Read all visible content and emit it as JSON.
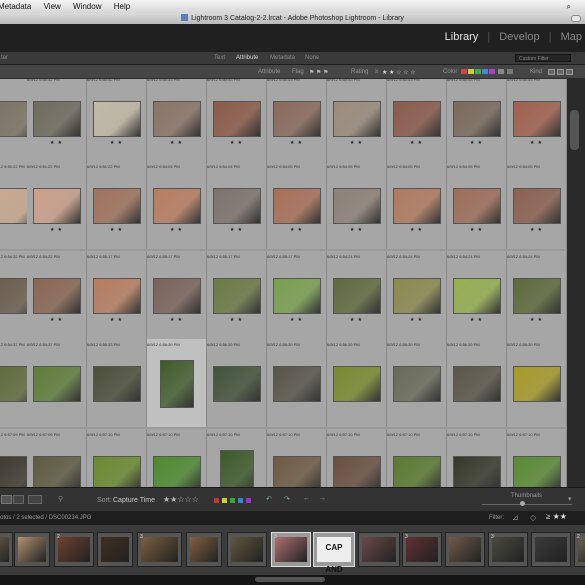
{
  "menubar": {
    "items": [
      "Metadata",
      "View",
      "Window",
      "Help"
    ]
  },
  "window": {
    "title": "Lightroom 3 Catalog-2-2.lrcat - Adobe Photoshop Lightroom - Library"
  },
  "modules": {
    "library": "Library",
    "develop": "Develop",
    "map": "Map",
    "sep": "|"
  },
  "filterbar": {
    "label": "ter",
    "text": "Text",
    "attribute": "Attribute",
    "metadata": "Metadata",
    "none": "None",
    "custom": "Custom Filter"
  },
  "attrbar": {
    "attribute": "Attribute",
    "flag": "Flag",
    "rating": "Rating",
    "rating_op": "≥",
    "color": "Color",
    "kind": "Kind"
  },
  "grid": {
    "rows": [
      {
        "info": [
          "",
          "6/9/12 6:50:52 PM",
          "6/9/12 6:50:52 PM",
          "6/9/12 6:50:53 PM",
          "6/9/12 6:50:53 PM",
          "6/9/12 6:50:53 PM",
          "6/9/12 6:50:53 PM",
          "6/9/12 6:50:53 PM",
          "6/9/12 6:50:53 PM",
          "6/9/12 6:50:53 PM"
        ],
        "stars": [
          "",
          "★ ★",
          "★ ★",
          "★ ★",
          "★ ★",
          "★ ★",
          "★ ★",
          "★ ★",
          "★ ★",
          "★ ★"
        ]
      },
      {
        "info": [
          "6/9/12 6:50:22 PM",
          "6/9/12 6:51:22 PM",
          "6/9/12 6:51:22 PM",
          "6/9/12 6:54:04 PM",
          "6/9/12 6:54:04 PM",
          "6/9/12 6:54:05 PM",
          "6/9/12 6:54:05 PM",
          "6/9/12 6:54:05 PM",
          "6/9/12 6:54:05 PM",
          "6/9/12 6:54:05 PM"
        ],
        "stars": [
          "",
          "★ ★",
          "★ ★",
          "★ ★",
          "★ ★",
          "★ ★",
          "★ ★",
          "★ ★",
          "★ ★",
          "★ ★"
        ]
      },
      {
        "info": [
          "6/9/12 6:54:22 PM",
          "6/9/12 6:54:22 PM",
          "6/9/12 6:55:17 PM",
          "6/9/12 6:55:17 PM",
          "6/9/12 6:55:17 PM",
          "6/9/12 6:55:17 PM",
          "6/9/12 6:54:24 PM",
          "6/9/12 6:54:24 PM",
          "6/9/12 6:54:24 PM",
          "6/9/12 6:54:24 PM"
        ],
        "stars": [
          "",
          "★ ★",
          "★ ★",
          "★ ★",
          "★ ★",
          "★ ★",
          "★ ★",
          "★ ★",
          "★ ★",
          "★ ★"
        ]
      },
      {
        "info": [
          "6/9/12 6:54:37 PM",
          "6/9/12 6:54:37 PM",
          "6/9/12 6:55:33 PM",
          "6/9/12 6:56:39 PM",
          "6/9/12 6:56:39 PM",
          "6/9/12 6:56:39 PM",
          "6/9/12 6:56:39 PM",
          "6/9/12 6:56:39 PM",
          "6/9/12 6:56:39 PM",
          "6/9/12 6:56:39 PM"
        ],
        "stars": [
          "",
          "",
          "",
          "",
          "",
          "",
          "",
          "",
          "",
          ""
        ]
      },
      {
        "info": [
          "6/9/12 6:57:09 PM",
          "6/9/12 6:57:09 PM",
          "6/9/12 6:57:10 PM",
          "6/9/12 6:57:10 PM",
          "6/9/12 6:57:10 PM",
          "6/9/12 6:57:10 PM",
          "6/9/12 6:57:10 PM",
          "6/9/12 6:57:10 PM",
          "6/9/12 6:57:10 PM",
          "6/9/12 6:57:10 PM"
        ],
        "stars": [
          "",
          "",
          "",
          "",
          "",
          "",
          "",
          "",
          "",
          ""
        ]
      }
    ]
  },
  "toolbar": {
    "sort_label": "Sort:",
    "sort_value": "Capture Time",
    "thumbnails": "Thumbnails"
  },
  "filmstrip": {
    "status": "otos / 2 selected / DSC00234.JPG",
    "filter_label": "Filter:",
    "tile_text": "CAP AND",
    "nums": [
      "2",
      "3",
      "3",
      "3",
      "3",
      "2"
    ]
  },
  "colors": {
    "accent": "#e6e6e6",
    "background": "#111111"
  }
}
